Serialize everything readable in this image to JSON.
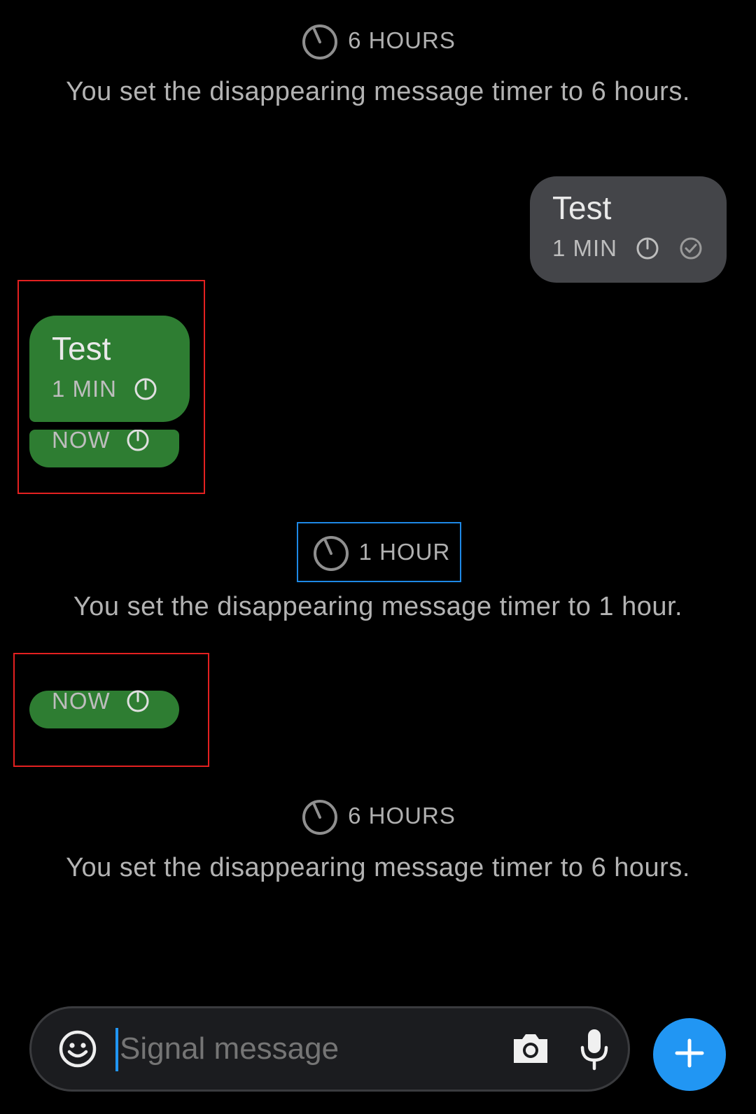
{
  "timeline": {
    "update1": {
      "label": "6 HOURS",
      "text": "You set the disappearing message timer to 6 hours."
    },
    "update2": {
      "label": "1 HOUR",
      "text": "You set the disappearing message timer to 1 hour."
    },
    "update3": {
      "label": "6 HOURS",
      "text": "You set the disappearing message timer to 6 hours."
    }
  },
  "messages": {
    "outgoing1": {
      "text": "Test",
      "meta": "1 MIN",
      "timer_icon": "timer-icon",
      "status_icon": "check-circle-icon"
    },
    "incoming1": {
      "text": "Test",
      "meta": "1 MIN",
      "timer_icon": "timer-icon"
    },
    "incoming2": {
      "meta": "NOW",
      "timer_icon": "timer-icon"
    },
    "incoming3": {
      "meta": "NOW",
      "timer_icon": "timer-icon"
    }
  },
  "composer": {
    "placeholder": "Signal message",
    "emoji_icon": "emoji-icon",
    "camera_icon": "camera-icon",
    "mic_icon": "mic-icon",
    "fab_icon": "plus-icon"
  },
  "colors": {
    "background": "#000000",
    "incoming_bubble": "#2e7d32",
    "outgoing_bubble": "#444549",
    "accent": "#2196f3",
    "highlight_red": "#e32020",
    "highlight_blue": "#1e88e5"
  }
}
